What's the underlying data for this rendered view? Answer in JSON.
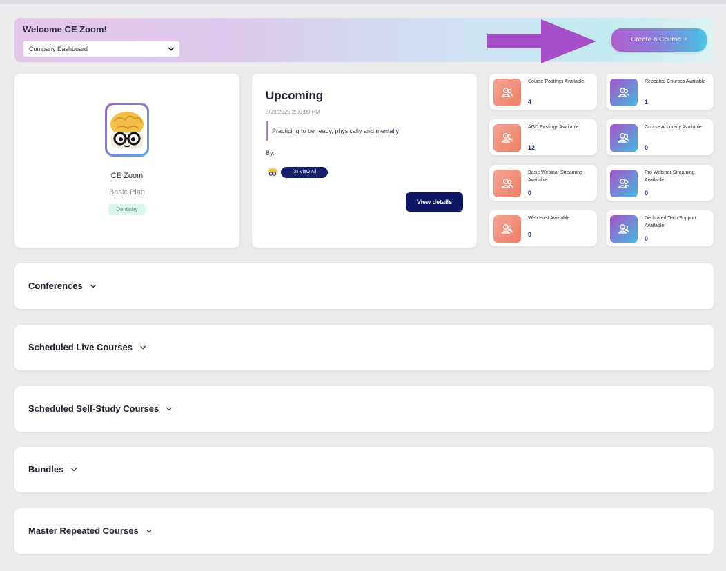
{
  "header": {
    "welcome": "Welcome CE Zoom!",
    "dashboard_select": "Company Dashboard",
    "create_course_label": "Create a Course +"
  },
  "profile": {
    "name": "CE Zoom",
    "plan": "Basic Plan",
    "badge": "Dentistry"
  },
  "upcoming": {
    "title": "Upcoming",
    "datetime": "3/29/2025 2:00:00 PM",
    "description": "Practicing to be ready, physically and mentally",
    "by_label": "By:",
    "view_all_label": "(2) View All",
    "view_details_label": "View details"
  },
  "stats": [
    {
      "label": "Course Postings Available",
      "count": "4",
      "color": "orange"
    },
    {
      "label": "Repeated Courses Available",
      "count": "1",
      "color": "purple"
    },
    {
      "label": "AGD Postings Available",
      "count": "12",
      "color": "orange"
    },
    {
      "label": "Course Accuracy Available",
      "count": "0",
      "color": "purple"
    },
    {
      "label": "Basic Webinar Streaming Available",
      "count": "0",
      "color": "orange"
    },
    {
      "label": "Pro Webinar Streaming Available",
      "count": "0",
      "color": "purple"
    },
    {
      "label": "Web Host Available",
      "count": "0",
      "color": "orange"
    },
    {
      "label": "Dedicated Tech Support Available",
      "count": "0",
      "color": "purple"
    }
  ],
  "sections": [
    {
      "title": "Conferences"
    },
    {
      "title": "Scheduled Live Courses"
    },
    {
      "title": "Scheduled Self-Study Courses"
    },
    {
      "title": "Bundles"
    },
    {
      "title": "Master Repeated Courses"
    }
  ],
  "colors": {
    "accent_navy": "#0e1766",
    "arrow_purple": "#a64dc9",
    "stat_orange": "#ef7f66",
    "stat_purple": "#a653c6",
    "badge_bg": "#d6f6ef"
  },
  "icons": {
    "select_chevron": "chevron-down-icon",
    "stat_icon": "users-icon",
    "section_chevron": "chevron-down-icon",
    "annotation": "right-arrow-annotation"
  }
}
